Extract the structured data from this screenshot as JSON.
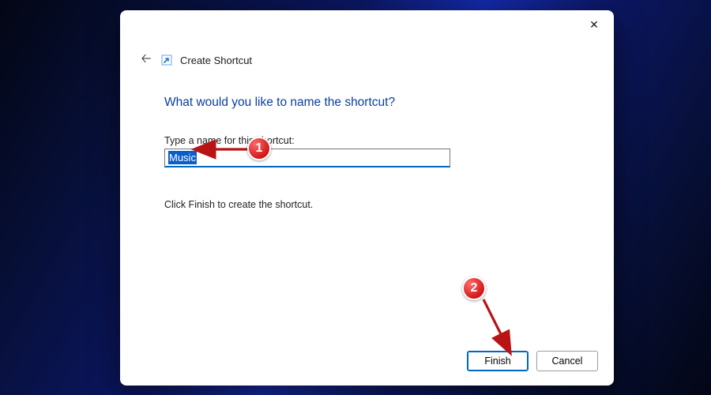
{
  "dialog": {
    "title": "Create Shortcut",
    "heading": "What would you like to name the shortcut?",
    "field_label": "Type a name for this shortcut:",
    "input_value": "Music",
    "instruction": "Click Finish to create the shortcut.",
    "buttons": {
      "finish": "Finish",
      "cancel": "Cancel"
    }
  },
  "annotations": {
    "step1": "1",
    "step2": "2"
  },
  "colors": {
    "accent": "#0067c0",
    "heading": "#0a3f9e",
    "annotation": "#d21919"
  }
}
